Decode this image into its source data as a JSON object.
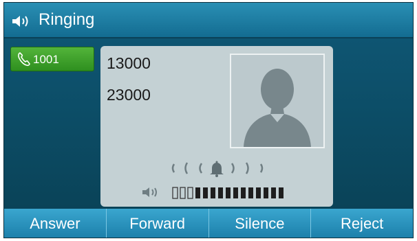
{
  "titlebar": {
    "title": "Ringing",
    "icon": "speaker-icon"
  },
  "line_key": {
    "label": "1001",
    "icon": "phone-icon",
    "color": "#3fa22c"
  },
  "call": {
    "caller_number": "13000",
    "called_number": "23000"
  },
  "ring_indicator": {
    "icon": "bell-icon"
  },
  "volume": {
    "level": 12,
    "max": 15,
    "icon": "speaker-icon"
  },
  "softkeys": [
    {
      "label": "Answer"
    },
    {
      "label": "Forward"
    },
    {
      "label": "Silence"
    },
    {
      "label": "Reject"
    }
  ],
  "colors": {
    "titlebar": "#1e7fa6",
    "background": "#0b4a63",
    "card": "#c4d1d4",
    "softkey": "#2a92bd"
  }
}
